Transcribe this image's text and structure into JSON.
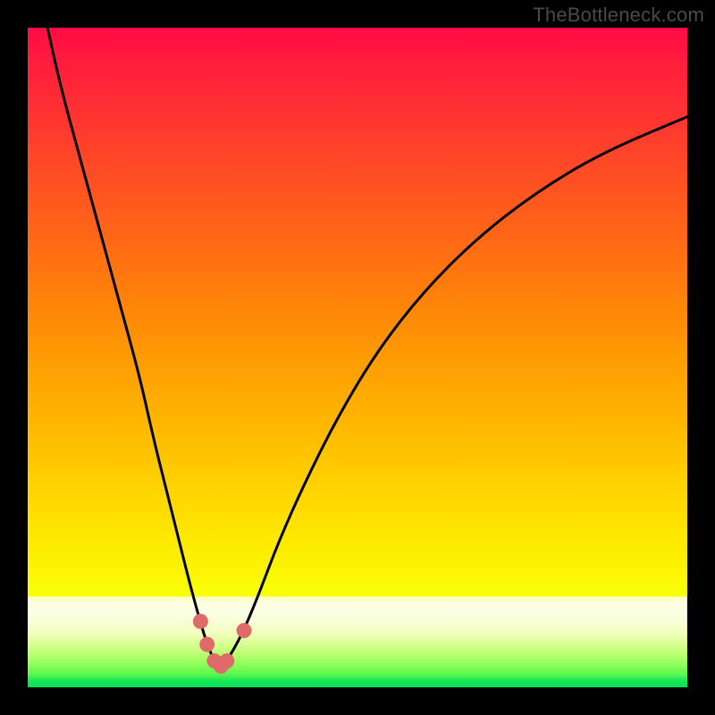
{
  "watermark": "TheBottleneck.com",
  "colors": {
    "frame": "#000000",
    "curve_stroke": "#000000",
    "marker_fill": "#e06a6a",
    "marker_stroke": "#c94f4f"
  },
  "chart_data": {
    "type": "line",
    "title": "",
    "xlabel": "",
    "ylabel": "",
    "xlim": [
      0,
      100
    ],
    "ylim": [
      0,
      100
    ],
    "grid": false,
    "legend": false,
    "series": [
      {
        "name": "bottleneck-curve",
        "x": [
          3,
          5,
          8,
          11,
          14,
          17,
          19,
          21,
          23,
          24.5,
          26,
          27.2,
          28.3,
          29.3,
          30.2,
          32.5,
          35,
          38,
          42,
          47,
          53,
          60,
          68,
          77,
          87,
          100
        ],
        "y": [
          100,
          91,
          80,
          69,
          58,
          47,
          38,
          30,
          22,
          16,
          10.5,
          6.5,
          4,
          3.2,
          4,
          8,
          14,
          22,
          31,
          41,
          51,
          60,
          68,
          75,
          81,
          86.5
        ]
      }
    ],
    "markers": [
      {
        "x": 26.2,
        "y": 10.0
      },
      {
        "x": 27.2,
        "y": 6.5
      },
      {
        "x": 28.3,
        "y": 4.0
      },
      {
        "x": 29.3,
        "y": 3.2
      },
      {
        "x": 30.2,
        "y": 4.0
      },
      {
        "x": 32.8,
        "y": 8.6
      }
    ],
    "background_gradient": {
      "orientation": "vertical",
      "stops": [
        {
          "pos": 0.0,
          "color": "#ff0b46"
        },
        {
          "pos": 0.5,
          "color": "#ff9a04"
        },
        {
          "pos": 0.86,
          "color": "#faff09"
        },
        {
          "pos": 0.88,
          "color": "#fcffe6"
        },
        {
          "pos": 1.0,
          "color": "#00e35c"
        }
      ]
    }
  }
}
